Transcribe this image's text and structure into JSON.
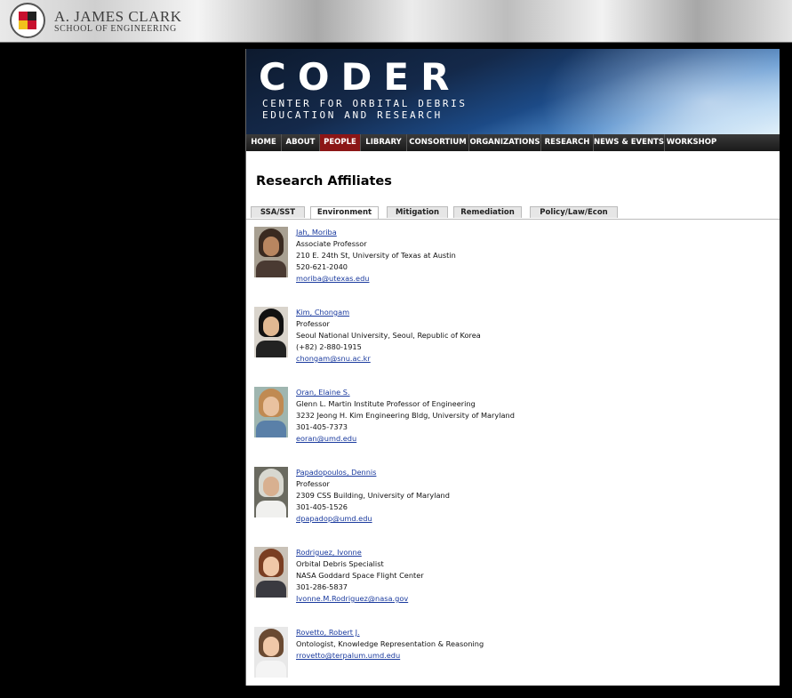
{
  "clark": {
    "name": "A. JAMES CLARK",
    "subtitle": "SCHOOL OF ENGINEERING",
    "seal_text": "UNIVERSITY OF MARYLAND"
  },
  "banner": {
    "title": "CODER",
    "subtitle_line1": "CENTER FOR ORBITAL DEBRIS",
    "subtitle_line2": "EDUCATION AND RESEARCH"
  },
  "nav": {
    "items": [
      "HOME",
      "ABOUT",
      "PEOPLE",
      "LIBRARY",
      "CONSORTIUM",
      "ORGANIZATIONS",
      "RESEARCH",
      "NEWS & EVENTS",
      "WORKSHOP"
    ],
    "active": "PEOPLE"
  },
  "page": {
    "title": "Research Affiliates"
  },
  "tabs": {
    "items": [
      "SSA/SST",
      "Environment",
      "Mitigation",
      "Remediation",
      "Policy/Law/Econ"
    ],
    "active": "Environment"
  },
  "people": [
    {
      "name": "Jah, Moriba",
      "title": "Associate Professor",
      "address": "210 E. 24th St, University of Texas at Austin",
      "phone": "520-621-2040",
      "email": "moriba@utexas.edu"
    },
    {
      "name": "Kim, Chongam",
      "title": "Professor",
      "address": "Seoul National University, Seoul, Republic of Korea",
      "phone": "(+82) 2-880-1915",
      "email": "chongam@snu.ac.kr"
    },
    {
      "name": "Oran, Elaine S.",
      "title": "Glenn L. Martin Institute Professor of Engineering",
      "address": "3232 Jeong H. Kim Engineering Bldg, University of Maryland",
      "phone": "301-405-7373",
      "email": "eoran@umd.edu"
    },
    {
      "name": "Papadopoulos, Dennis",
      "title": "Professor",
      "address": "2309 CSS Building, University of Maryland",
      "phone": "301-405-1526",
      "email": "dpapadop@umd.edu"
    },
    {
      "name": "Rodriguez, Ivonne",
      "title": "Orbital Debris Specialist",
      "address": "NASA Goddard Space Flight Center",
      "phone": "301-286-5837",
      "email": "Ivonne.M.Rodriguez@nasa.gov"
    },
    {
      "name": "Rovetto, Robert J.",
      "title": "Ontologist, Knowledge Representation & Reasoning",
      "address": "",
      "phone": "",
      "email": "rrovetto@terpalum.umd.edu"
    }
  ],
  "colors": {
    "nav_active": "#8b1616",
    "link": "#1a3a9e",
    "background": "#000000"
  }
}
